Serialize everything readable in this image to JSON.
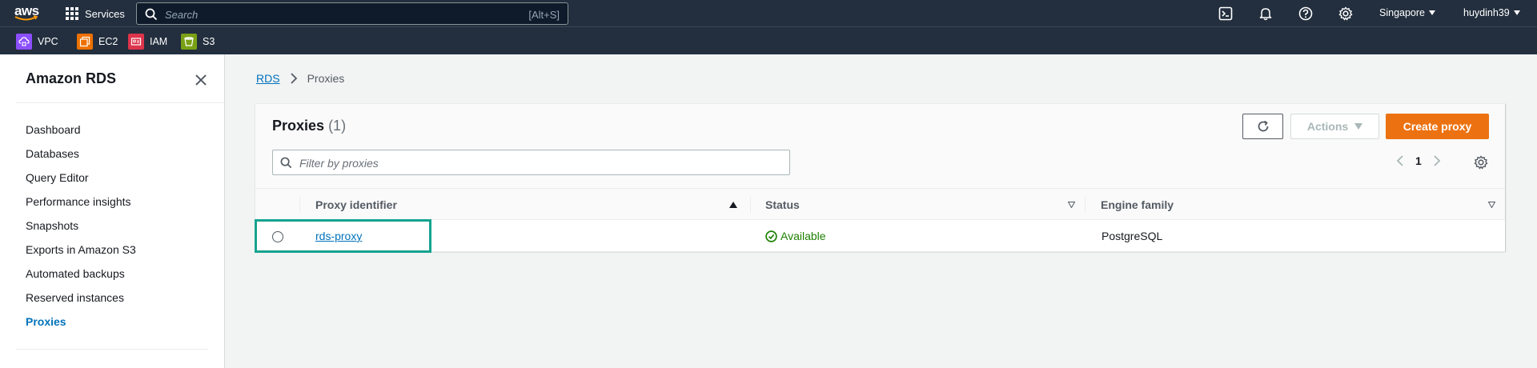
{
  "topnav": {
    "logo_text": "aws",
    "services_label": "Services",
    "search_placeholder": "Search",
    "search_shortcut": "[Alt+S]",
    "region": "Singapore",
    "user": "huydinh39"
  },
  "favorites": [
    {
      "label": "VPC",
      "color": "#8c4fff"
    },
    {
      "label": "EC2",
      "color": "#ed7100"
    },
    {
      "label": "IAM",
      "color": "#dd344c"
    },
    {
      "label": "S3",
      "color": "#7aa116"
    }
  ],
  "sidebar": {
    "title": "Amazon RDS",
    "items": [
      {
        "label": "Dashboard"
      },
      {
        "label": "Databases"
      },
      {
        "label": "Query Editor"
      },
      {
        "label": "Performance insights"
      },
      {
        "label": "Snapshots"
      },
      {
        "label": "Exports in Amazon S3"
      },
      {
        "label": "Automated backups"
      },
      {
        "label": "Reserved instances"
      },
      {
        "label": "Proxies",
        "active": true
      }
    ]
  },
  "breadcrumb": {
    "root": "RDS",
    "current": "Proxies"
  },
  "panel": {
    "title": "Proxies",
    "count": "(1)",
    "actions_label": "Actions",
    "create_label": "Create proxy",
    "filter_placeholder": "Filter by proxies",
    "page": "1"
  },
  "table": {
    "columns": [
      "Proxy identifier",
      "Status",
      "Engine family"
    ],
    "rows": [
      {
        "identifier": "rds-proxy",
        "status": "Available",
        "engine": "PostgreSQL"
      }
    ]
  },
  "colors": {
    "accent": "#0073bb",
    "primary_button": "#ec7211",
    "status_ok": "#1d8102",
    "highlight": "#15a38f"
  }
}
